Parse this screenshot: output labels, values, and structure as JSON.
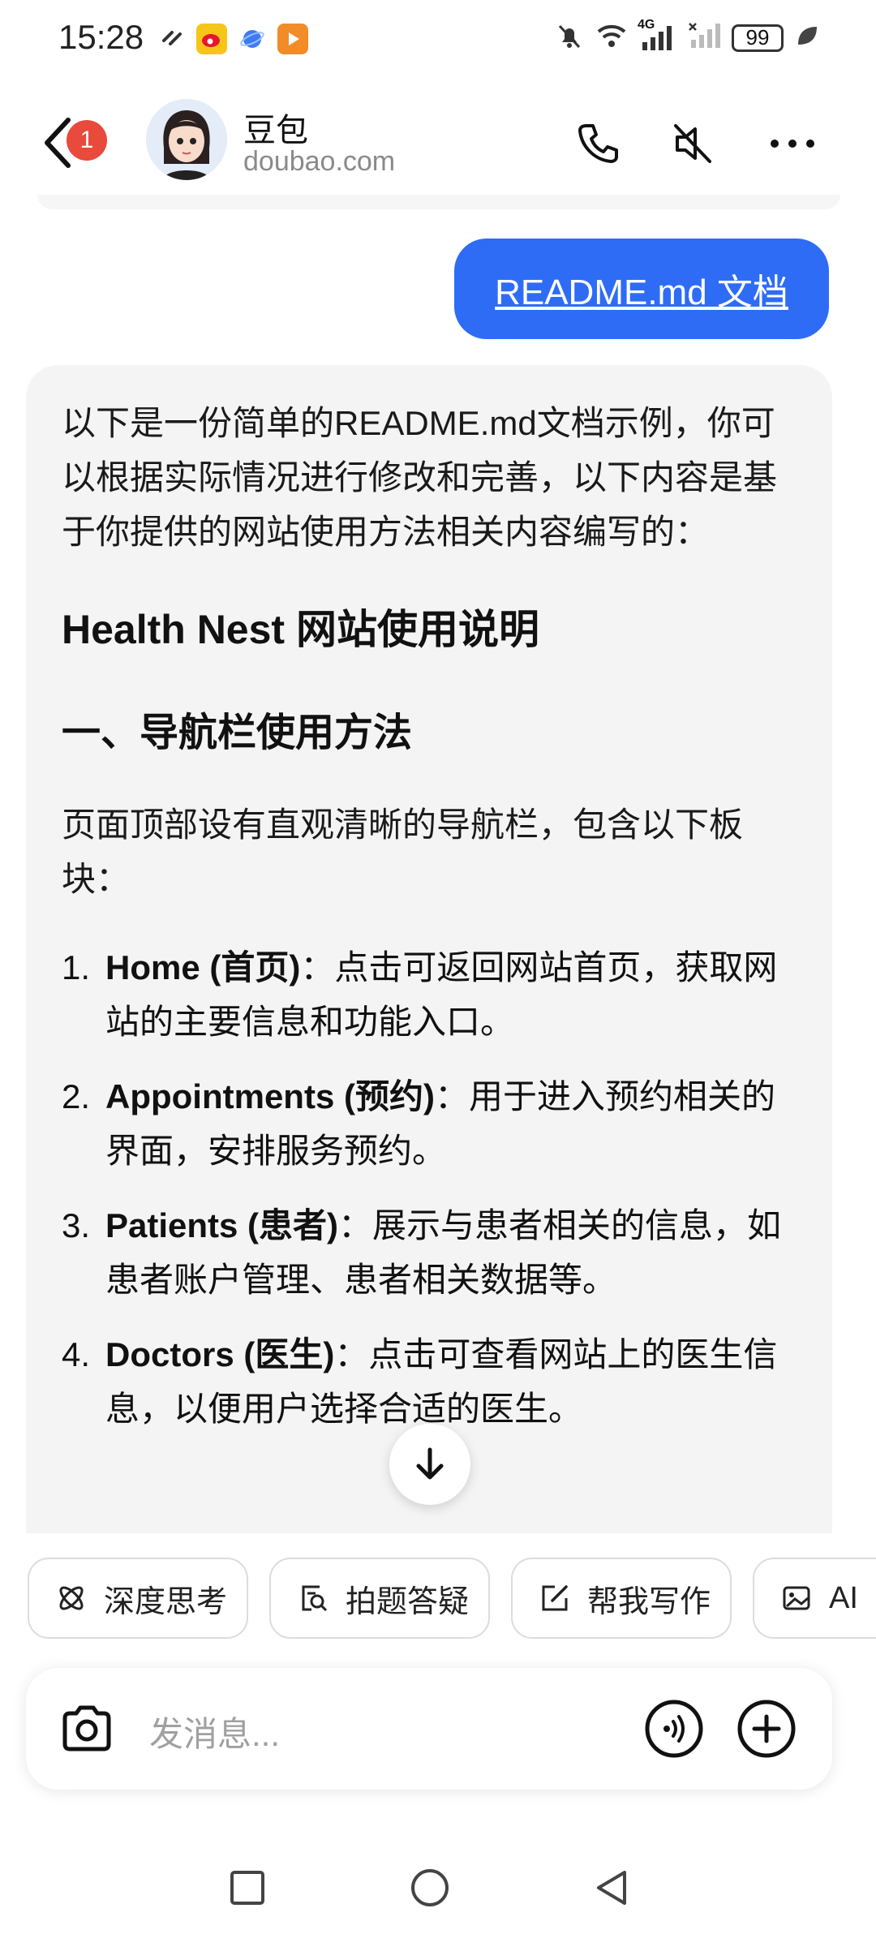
{
  "status_bar": {
    "time": "15:28",
    "battery": "99",
    "network": "4G",
    "left_icons": [
      "link-icon",
      "weibo-icon",
      "browser-icon",
      "video-app-icon"
    ],
    "right_icons": [
      "mute-bell-icon",
      "wifi-icon",
      "signal-icon",
      "no-signal-icon",
      "battery-icon",
      "leaf-icon"
    ]
  },
  "header": {
    "unread_badge": "1",
    "contact_name": "豆包",
    "contact_domain": "doubao.com"
  },
  "user_message": {
    "text": "README.md 文档"
  },
  "assistant_message": {
    "intro": "以下是一份简单的README.md文档示例，你可以根据实际情况进行修改和完善，以下内容是基于你提供的网站使用方法相关内容编写的：",
    "title": "Health Nest 网站使用说明",
    "section_heading": "一、导航栏使用方法",
    "section_intro": "页面顶部设有直观清晰的导航栏，包含以下板块：",
    "items": [
      {
        "num": "1.",
        "label": "Home (首页)",
        "desc": "：点击可返回网站首页，获取网站的主要信息和功能入口。"
      },
      {
        "num": "2.",
        "label": "Appointments (预约)",
        "desc": "：用于进入预约相关的界面，安排服务预约。"
      },
      {
        "num": "3.",
        "label": "Patients (患者)",
        "desc": "：展示与患者相关的信息，如患者账户管理、患者相关数据等。"
      },
      {
        "num": "4.",
        "label": "Doctors (医生)",
        "desc": "：点击可查看网站上的医生信息，以便用户选择合适的医生。"
      }
    ]
  },
  "quick_actions": [
    {
      "icon": "atom-icon",
      "label": "深度思考"
    },
    {
      "icon": "photo-search-icon",
      "label": "拍题答疑"
    },
    {
      "icon": "edit-icon",
      "label": "帮我写作"
    },
    {
      "icon": "image-icon",
      "label": "AI"
    }
  ],
  "composer": {
    "placeholder": "发消息..."
  },
  "colors": {
    "accent": "#2e6cf6",
    "badge": "#e84a3c",
    "card_bg": "#f4f4f5"
  }
}
